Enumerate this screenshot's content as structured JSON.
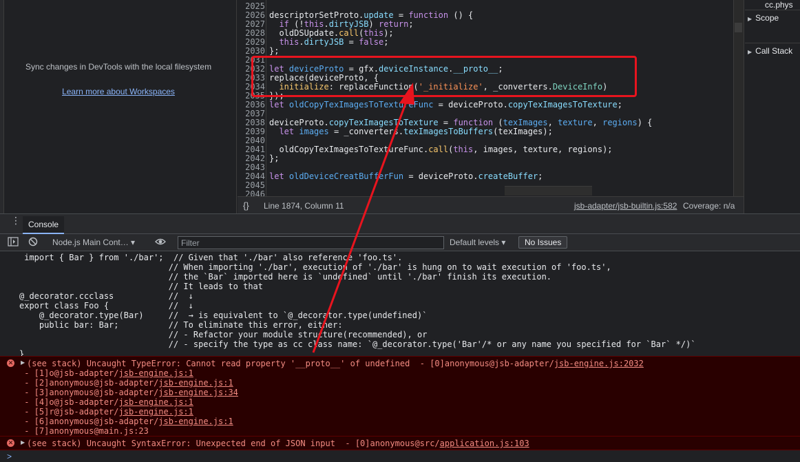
{
  "workspace": {
    "sync_text": "Sync changes in DevTools with the local filesystem",
    "learn_link": "Learn more about Workspaces"
  },
  "editor": {
    "lines": [
      {
        "n": "2025",
        "html": ""
      },
      {
        "n": "2026",
        "html": "descriptorSetProto.<span class='prop'>update</span> = <span class='kw'>function</span> () {"
      },
      {
        "n": "2027",
        "html": "  <span class='kw'>if</span> (!<span class='kw'>this</span>.<span class='prop'>dirtyJSB</span>) <span class='kw'>return</span>;"
      },
      {
        "n": "2028",
        "html": "  oldDSUpdate.<span class='fn'>call</span>(<span class='kw'>this</span>);"
      },
      {
        "n": "2029",
        "html": "  <span class='kw'>this</span>.<span class='prop'>dirtyJSB</span> = <span class='kw'>false</span>;"
      },
      {
        "n": "2030",
        "html": "};"
      },
      {
        "n": "2031",
        "html": ""
      },
      {
        "n": "2032",
        "html": "<span class='kw'>let</span> <span class='blue'>deviceProto</span> = gfx.<span class='prop'>deviceInstance</span>.<span class='prop'>__proto__</span>;"
      },
      {
        "n": "2033",
        "html": "replace(deviceProto, {"
      },
      {
        "n": "2034",
        "html": "  <span class='fn'>initialize</span>: replaceFunction(<span class='str'>'_initialize'</span>, _converters.<span class='cls'>DeviceInfo</span>)"
      },
      {
        "n": "2035",
        "html": "});"
      },
      {
        "n": "2036",
        "html": "<span class='kw'>let</span> <span class='blue'>oldCopyTexImagesToTextureFunc</span> = deviceProto.<span class='prop'>copyTexImagesToTexture</span>;"
      },
      {
        "n": "2037",
        "html": ""
      },
      {
        "n": "2038",
        "html": "deviceProto.<span class='prop'>copyTexImagesToTexture</span> = <span class='kw'>function</span> (<span class='blue'>texImages</span>, <span class='blue'>texture</span>, <span class='blue'>regions</span>) {"
      },
      {
        "n": "2039",
        "html": "  <span class='kw'>let</span> <span class='blue'>images</span> = _converters.<span class='prop'>texImagesToBuffers</span>(texImages);"
      },
      {
        "n": "2040",
        "html": ""
      },
      {
        "n": "2041",
        "html": "  oldCopyTexImagesToTextureFunc.<span class='fn'>call</span>(<span class='kw'>this</span>, images, texture, regions);"
      },
      {
        "n": "2042",
        "html": "};"
      },
      {
        "n": "2043",
        "html": ""
      },
      {
        "n": "2044",
        "html": "<span class='kw'>let</span> <span class='blue'>oldDeviceCreatBufferFun</span> = deviceProto.<span class='prop'>createBuffer</span>;"
      },
      {
        "n": "2045",
        "html": ""
      },
      {
        "n": "2046",
        "html": ""
      }
    ]
  },
  "status": {
    "braces": "{}",
    "position": "Line 1874, Column 11",
    "file_link": "jsb-adapter/jsb-builtin.js:582",
    "coverage": "Coverage: n/a"
  },
  "sidebar": {
    "top_text": "cc.phys",
    "scope": "Scope",
    "call_stack": "Call Stack"
  },
  "console": {
    "tab_label": "Console",
    "context": "Node.js Main Cont… ▾",
    "filter_placeholder": "Filter",
    "levels": "Default levels ▾",
    "issues": "No Issues",
    "log_lines": [
      " import { Bar } from './bar';  // Given that './bar' also reference 'foo.ts'.",
      "                              // When importing './bar', execution of './bar' is hung on to wait execution of 'foo.ts',",
      "                              // the `Bar` imported here is `undefined` until './bar' finish its execution.",
      "                              // It leads to that",
      "@_decorator.ccclass           //  ↓",
      "export class Foo {            //  ↓",
      "    @_decorator.type(Bar)     //  → is equivalent to `@_decorator.type(undefined)`",
      "    public bar: Bar;          // To eliminate this error, either:",
      "                              // - Refactor your module structure(recommended), or",
      "                              // - specify the type as cc class name: `@_decorator.type('Bar'/* or any name you specified for `Bar` */)`",
      "}"
    ],
    "error1": {
      "head": "(see stack) Uncaught TypeError: Cannot read property '__proto__' of undefined  - [0]anonymous@jsb-adapter/",
      "head_link": "jsb-engine.js:2032",
      "frames": [
        {
          "prefix": " - [1]o@jsb-adapter/",
          "link": "jsb-engine.js:1"
        },
        {
          "prefix": " - [2]anonymous@jsb-adapter/",
          "link": "jsb-engine.js:1"
        },
        {
          "prefix": " - [3]anonymous@jsb-adapter/",
          "link": "jsb-engine.js:34"
        },
        {
          "prefix": " - [4]o@jsb-adapter/",
          "link": "jsb-engine.js:1"
        },
        {
          "prefix": " - [5]r@jsb-adapter/",
          "link": "jsb-engine.js:1"
        },
        {
          "prefix": " - [6]anonymous@jsb-adapter/",
          "link": "jsb-engine.js:1"
        },
        {
          "prefix": " - [7]anonymous@main.js:23",
          "link": ""
        }
      ]
    },
    "error2": {
      "head": "(see stack) Uncaught SyntaxError: Unexpected end of JSON input  - [0]anonymous@src/",
      "head_link": "application.js:103"
    },
    "prompt": ">"
  },
  "colors": {
    "highlight": "#e8141e",
    "error_bg": "#290000",
    "error_text": "#f28b82"
  }
}
